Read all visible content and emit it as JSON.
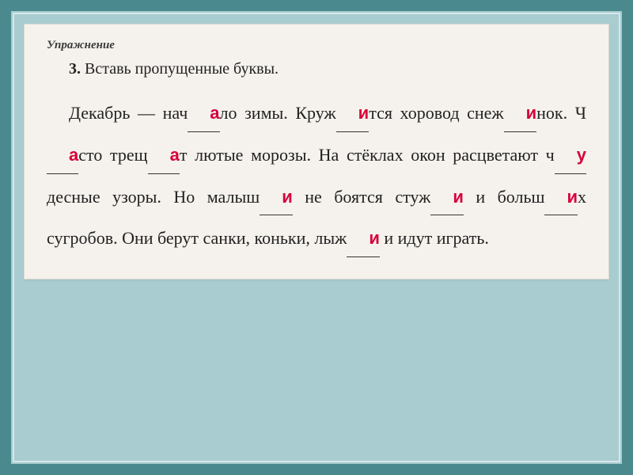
{
  "exercise_label": "Упражнение",
  "task_number": "3.",
  "task_text": "Вставь пропущенные буквы.",
  "segments": {
    "s1": "Декабрь — нач",
    "b1": "а",
    "s2": "ло зимы. Круж",
    "b2": "и",
    "s3": "тся хоровод снеж",
    "b3": "и",
    "s4": "нок. Ч",
    "b4": "а",
    "s5": "сто трещ",
    "b5": "а",
    "s6": "т лютые морозы. На стёклах окон расцветают ч",
    "b6": "у",
    "s7": "десные узоры. Но ма­лыш",
    "b7": "и",
    "s8": " не боятся стуж",
    "b8": "и",
    "s9": " и больш",
    "b9": "и",
    "s10": "х сугробов. Они берут санки, коньки, лыж",
    "b10": "и",
    "s11": " и идут играть."
  }
}
